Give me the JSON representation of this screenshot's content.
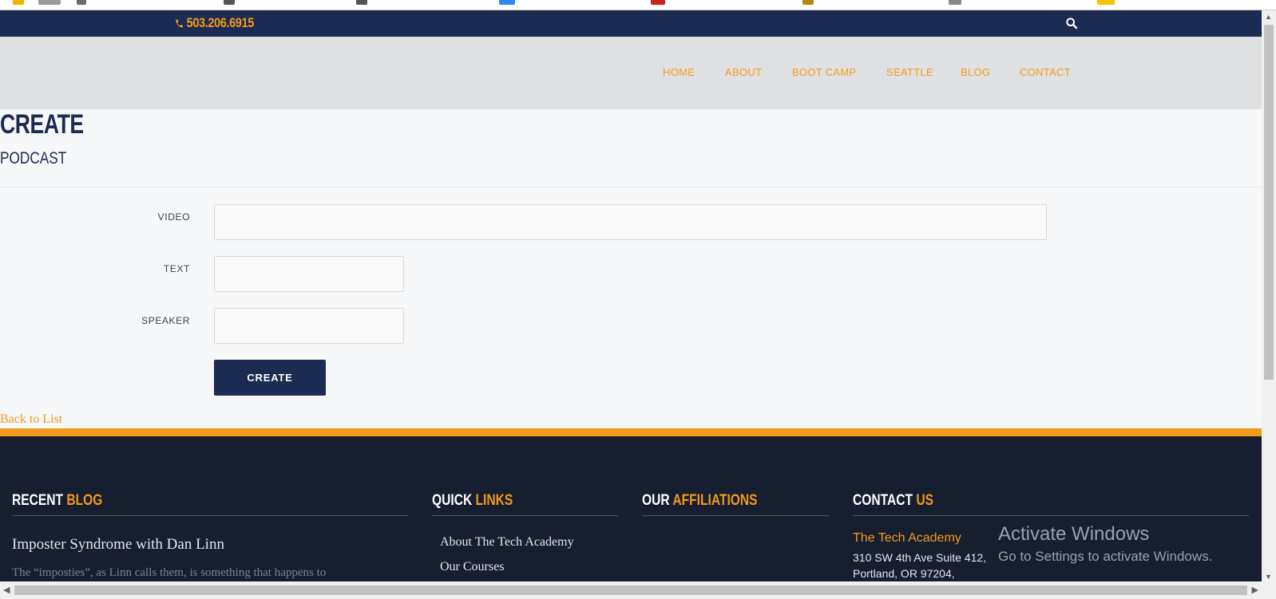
{
  "colors": {
    "navy": "#1c2b51",
    "accent": "#f29a1b",
    "nav_bg": "#dfe0e2",
    "main_bg": "#f6f7f9",
    "footer_bg": "#161e30"
  },
  "topbar": {
    "phone_icon": "phone-icon",
    "phone": "503.206.6915",
    "search_icon": "search-icon"
  },
  "nav": {
    "items": [
      {
        "label": "HOME"
      },
      {
        "label": "ABOUT"
      },
      {
        "label": "BOOT CAMP"
      },
      {
        "label": "SEATTLE"
      },
      {
        "label": "BLOG"
      },
      {
        "label": "CONTACT"
      }
    ]
  },
  "page": {
    "title": "CREATE",
    "subtitle": "PODCAST"
  },
  "form": {
    "fields": [
      {
        "label": "VIDEO",
        "value": ""
      },
      {
        "label": "TEXT",
        "value": ""
      },
      {
        "label": "SPEAKER",
        "value": ""
      }
    ],
    "submit_label": "CREATE",
    "back_link": "Back to List"
  },
  "footer": {
    "columns": [
      {
        "title": "RECENT",
        "accent": "BLOG"
      },
      {
        "title": "QUICK",
        "accent": "LINKS"
      },
      {
        "title": "OUR",
        "accent": "AFFILIATIONS"
      },
      {
        "title": "CONTACT",
        "accent": "US"
      }
    ],
    "blog": {
      "title": "Imposter Syndrome with Dan Linn",
      "excerpt": "The “imposties”, as Linn calls them, is something that happens to"
    },
    "quick_links": [
      {
        "label": "About The Tech Academy"
      },
      {
        "label": "Our Courses"
      }
    ],
    "contact": {
      "name": "The Tech Academy",
      "address_line1": "310 SW 4th Ave Suite 412,",
      "address_line2": "Portland, OR 97204,"
    }
  },
  "watermark": {
    "title": "Activate Windows",
    "subtitle": "Go to Settings to activate Windows."
  }
}
